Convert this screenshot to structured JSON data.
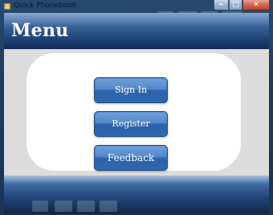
{
  "window": {
    "title": "Quick Phonebook",
    "controls": {
      "minimize_icon": "minimize-icon",
      "maximize_icon": "maximize-icon",
      "close_icon": "close-icon"
    }
  },
  "header": {
    "title": "Menu"
  },
  "menu": {
    "buttons": [
      {
        "label": "Sign In"
      },
      {
        "label": "Register"
      },
      {
        "label": "Feedback"
      }
    ]
  },
  "colors": {
    "header_blue": "#22497f",
    "button_blue": "#3f79c3",
    "panel_bg": "#ffffff",
    "content_bg": "#dcdcdc"
  }
}
